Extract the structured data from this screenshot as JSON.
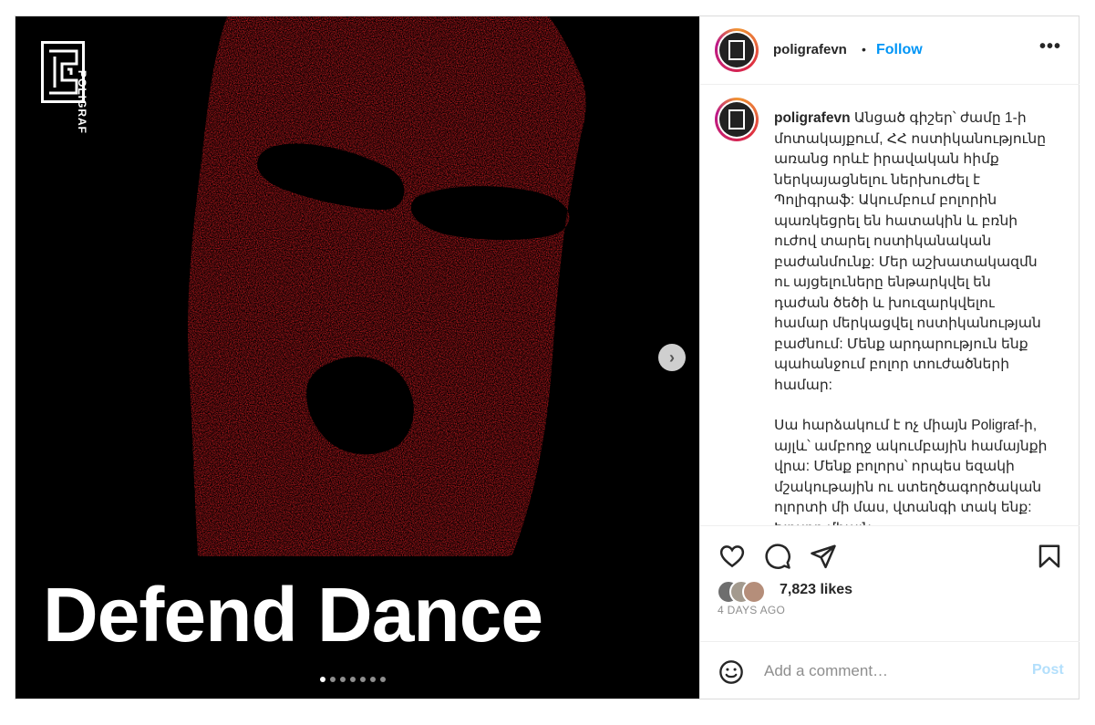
{
  "post": {
    "media": {
      "logo_text": "POLIGRAF",
      "headline": "Defend Dance",
      "mask_color": "#ee1f25",
      "carousel_dots": 7,
      "active_dot": 0,
      "next_icon": "chevron-right-icon"
    },
    "header": {
      "username": "poligrafevn",
      "separator": "•",
      "follow_label": "Follow",
      "more_icon": "more-horizontal-icon",
      "more_label": "•••"
    },
    "caption": {
      "username": "poligrafevn",
      "paragraph1": "Անցած գիշեր՝ ժամը 1-ի մոտակայքում, ՀՀ ոստիկանությունը առանց որևէ իրավական հիմք ներկայացնելու ներխուժել է Պոլիգրաֆ: Ակումբում բոլորին պառկեցրել են հատակին և բռնի ուժով տարել ոստիկանական բաժանմունք: Մեր աշխատակազմն ու այցելուները ենթարկվել են դաժան ծեծի և խուզարկվելու համար մերկացվել ոստիկանության բաժնում: Մենք արդարություն ենք պահանջում բոլոր տուժածների համար:",
      "paragraph2": "Սա հարձակում է ոչ միայն Poligraf-ի, այլև՝ ամբողջ ակումբային համայնքի վրա: Մենք բոլորս՝ որպես եզակի մշակութային ու ստեղծագործական ոլորտի մի մաս, վտանգի տակ ենք: Խոսքը միայն"
    },
    "actions": {
      "like_icon": "heart-icon",
      "comment_icon": "comment-icon",
      "share_icon": "paper-plane-icon",
      "save_icon": "bookmark-icon"
    },
    "likes": "7,823 likes",
    "date": "4 DAYS AGO",
    "comment_box": {
      "emoji_icon": "emoji-icon",
      "placeholder": "Add a comment…",
      "post_label": "Post"
    }
  }
}
